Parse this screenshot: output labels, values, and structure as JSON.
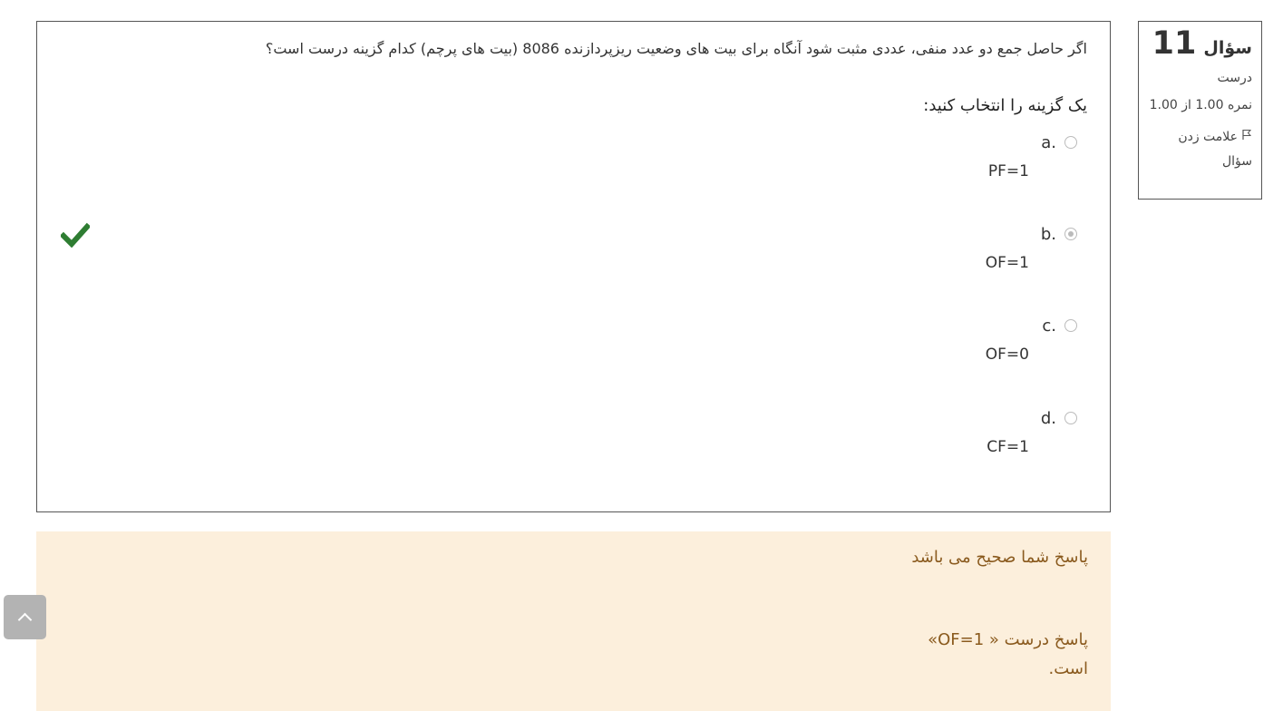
{
  "info": {
    "question_label": "سؤال",
    "question_number": "11",
    "state": "درست",
    "grade": "نمره 1.00 از 1.00",
    "flag_label": "علامت زدن سؤال"
  },
  "question": {
    "text": "اگر حاصل جمع دو عدد منفی، عددی مثبت شود آنگاه برای بیت های وضعیت ریزپردازنده 8086 (بیت های پرچم) کدام گزینه درست است؟",
    "prompt": "یک گزینه را انتخاب کنید:",
    "options": [
      {
        "letter": "a.",
        "value": "PF=1",
        "selected": false
      },
      {
        "letter": "b.",
        "value": "OF=1",
        "selected": true
      },
      {
        "letter": "c.",
        "value": "OF=0",
        "selected": false
      },
      {
        "letter": "d.",
        "value": "CF=1",
        "selected": false
      }
    ]
  },
  "feedback": {
    "general": "پاسخ شما صحیح می باشد",
    "right_answer": "پاسخ درست « OF=1» است."
  },
  "colors": {
    "correct": "#2e7d32",
    "feedback_bg": "#fcefdc",
    "feedback_text": "#8a5a1e"
  },
  "icons": {
    "flag": "flag-icon",
    "correct": "check-icon",
    "back_to_top": "chevron-up-icon"
  }
}
